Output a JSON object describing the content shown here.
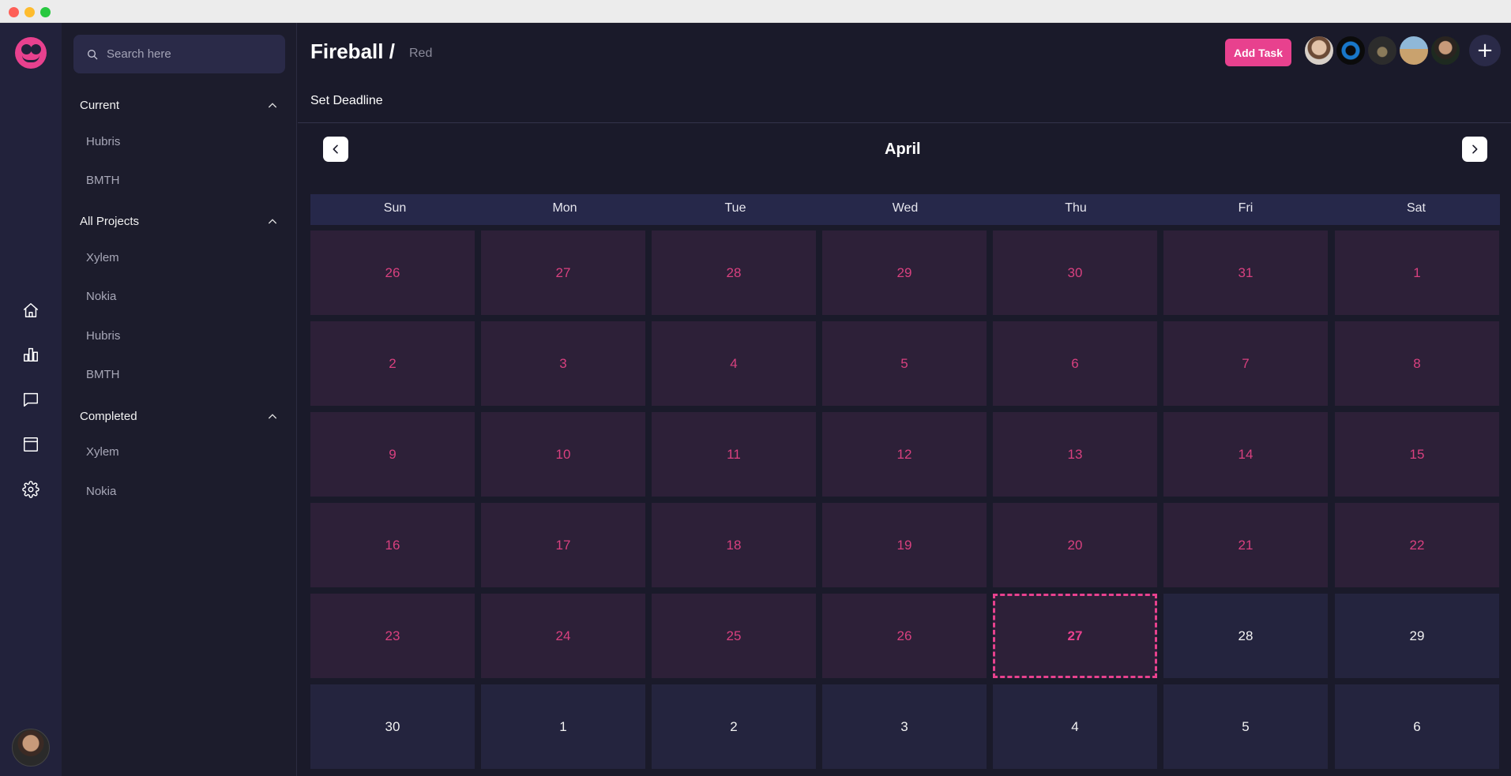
{
  "window": {
    "controls": [
      "close",
      "minimize",
      "maximize"
    ]
  },
  "rail": {
    "logo_icon": "logo-icon",
    "icons": [
      "home-icon",
      "chart-icon",
      "chat-icon",
      "calendar-window-icon",
      "gear-icon"
    ]
  },
  "search": {
    "placeholder": "Search here",
    "value": ""
  },
  "sidebar": {
    "sections": [
      {
        "title": "Current",
        "items": [
          "Hubris",
          "BMTH"
        ]
      },
      {
        "title": "All Projects",
        "items": [
          "Xylem",
          "Nokia",
          "Hubris",
          "BMTH"
        ]
      },
      {
        "title": "Completed",
        "items": [
          "Xylem",
          "Nokia"
        ]
      }
    ]
  },
  "header": {
    "title": "Fireball /",
    "subtitle": "Red",
    "add_task_label": "Add Task",
    "add_member_label": "+"
  },
  "toolbar": {
    "set_deadline_label": "Set Deadline"
  },
  "calendar": {
    "month": "April",
    "weekdays": [
      "Sun",
      "Mon",
      "Tue",
      "Wed",
      "Thu",
      "Fri",
      "Sat"
    ],
    "weeks": [
      [
        "26",
        "27",
        "28",
        "29",
        "30",
        "31",
        "1"
      ],
      [
        "2",
        "3",
        "4",
        "5",
        "6",
        "7",
        "8"
      ],
      [
        "9",
        "10",
        "11",
        "12",
        "13",
        "14",
        "15"
      ],
      [
        "16",
        "17",
        "18",
        "19",
        "20",
        "21",
        "22"
      ],
      [
        "23",
        "24",
        "25",
        "26",
        "27",
        "28",
        "29"
      ],
      [
        "30",
        "1",
        "2",
        "3",
        "4",
        "5",
        "6"
      ]
    ],
    "today_label": "27"
  },
  "colors": {
    "accent": "#e8418e",
    "past_cell": "#2d2038",
    "future_cell": "#24243e",
    "background": "#1a1a2a"
  }
}
